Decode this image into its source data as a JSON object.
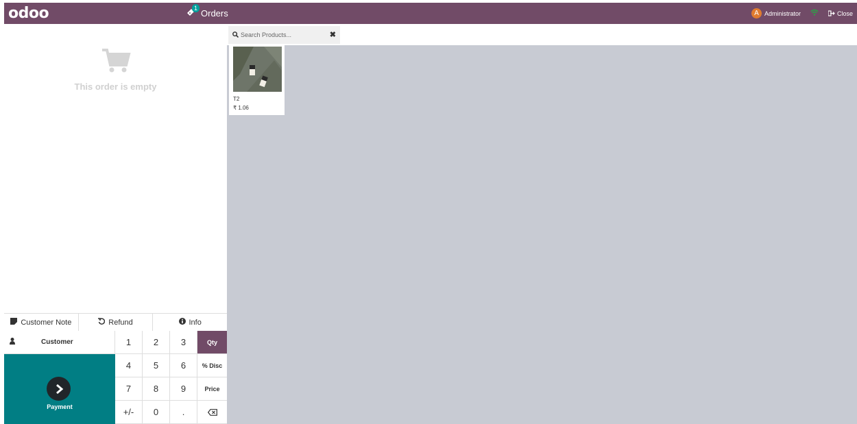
{
  "topbar": {
    "logo": "odoo",
    "orders_label": "Orders",
    "orders_badge": "1",
    "user_initial": "A",
    "user_name": "Administrator",
    "close_label": "Close"
  },
  "order": {
    "empty_message": "This order is empty"
  },
  "controls": {
    "customer_note": "Customer Note",
    "refund": "Refund",
    "info": "Info",
    "customer": "Customer",
    "payment": "Payment"
  },
  "numpad": {
    "keys": [
      "1",
      "2",
      "3",
      "4",
      "5",
      "6",
      "7",
      "8",
      "9",
      "+/-",
      "0",
      "."
    ],
    "modes": [
      "Qty",
      "% Disc",
      "Price"
    ],
    "active_mode": "Qty"
  },
  "search": {
    "placeholder": "Search Products..."
  },
  "products": [
    {
      "name": "T2",
      "price": "₹ 1.06"
    }
  ],
  "colors": {
    "brand": "#714b67",
    "payment": "#017e84",
    "product_area": "#c8cbd3"
  }
}
